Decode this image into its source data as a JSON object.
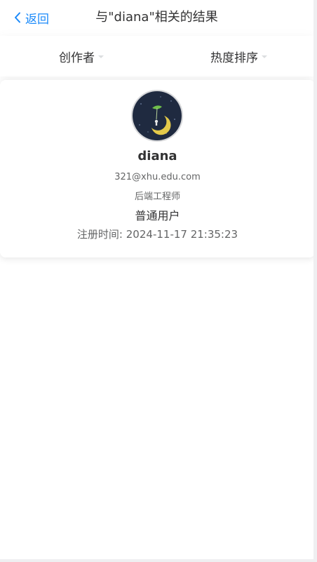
{
  "nav": {
    "back_label": "返回",
    "title": "与\"diana\"相关的结果"
  },
  "filters": [
    {
      "label": "创作者",
      "icon": "caret-down-icon"
    },
    {
      "label": "热度排序",
      "icon": "caret-down-icon"
    }
  ],
  "result_user": {
    "username": "diana",
    "email": "321@xhu.edu.com",
    "position": "后端工程师",
    "role": "普通用户",
    "registered_label": "注册时间:",
    "registered_time": "2024-11-17 21:35:23"
  },
  "colors": {
    "accent": "#1989fa",
    "text": "#323233",
    "muted": "#646566",
    "avatar_bg": "#1f2a40"
  }
}
